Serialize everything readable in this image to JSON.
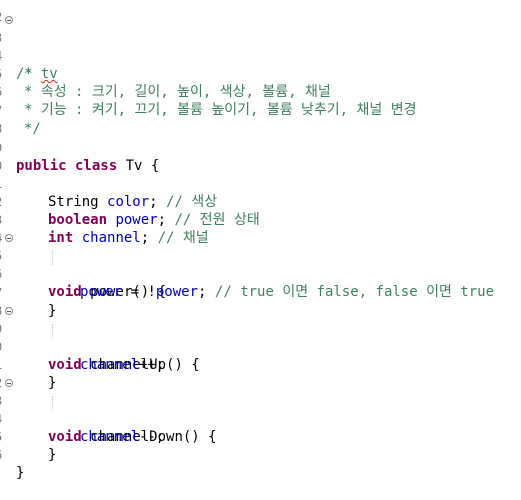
{
  "editor": {
    "line_numbers": [
      "2",
      "3",
      "4",
      "5",
      "6",
      "7",
      "8",
      "9",
      "0",
      "1",
      "2",
      "3",
      "4",
      "5",
      "6",
      "7",
      "8",
      "9",
      "0",
      "1",
      "2",
      "3",
      "4",
      "5",
      "6"
    ],
    "comment_open": "/*",
    "comment_star": "*",
    "comment_title": "tv",
    "comment_attrs": "* 속성 : 크기, 길이, 높이, 색상, 볼륨, 채널",
    "comment_funcs": "* 기능 : 켜기, 끄기, 볼륨 높이기, 볼륨 낮추기, 채널 변경",
    "comment_close": "*/",
    "class_kw": "public class",
    "class_name": "Tv {",
    "field1_type": "String",
    "field1_name": "color",
    "field1_comment": "// 색상",
    "field2_type": "boolean",
    "field2_name": "power",
    "field2_comment": "// 전원 상태",
    "field3_type": "int",
    "field3_name": "channel",
    "field3_comment": "// 채널",
    "m1_kw": "void",
    "m1_sig": "power() {",
    "m1_field": "power",
    "m1_eq": " = !",
    "m1_field2": "power",
    "m1_semi": ";",
    "m1_comment": "// true 이면 false, false 이면 true",
    "close_brace": "}",
    "m2_kw": "void",
    "m2_sig": "channelUp() {",
    "m2_field": "channel",
    "m2_op": "++;",
    "m3_kw": "void",
    "m3_sig": "channelDown() {",
    "m3_field": "channel",
    "m3_op": "--;",
    "semi": ";"
  }
}
